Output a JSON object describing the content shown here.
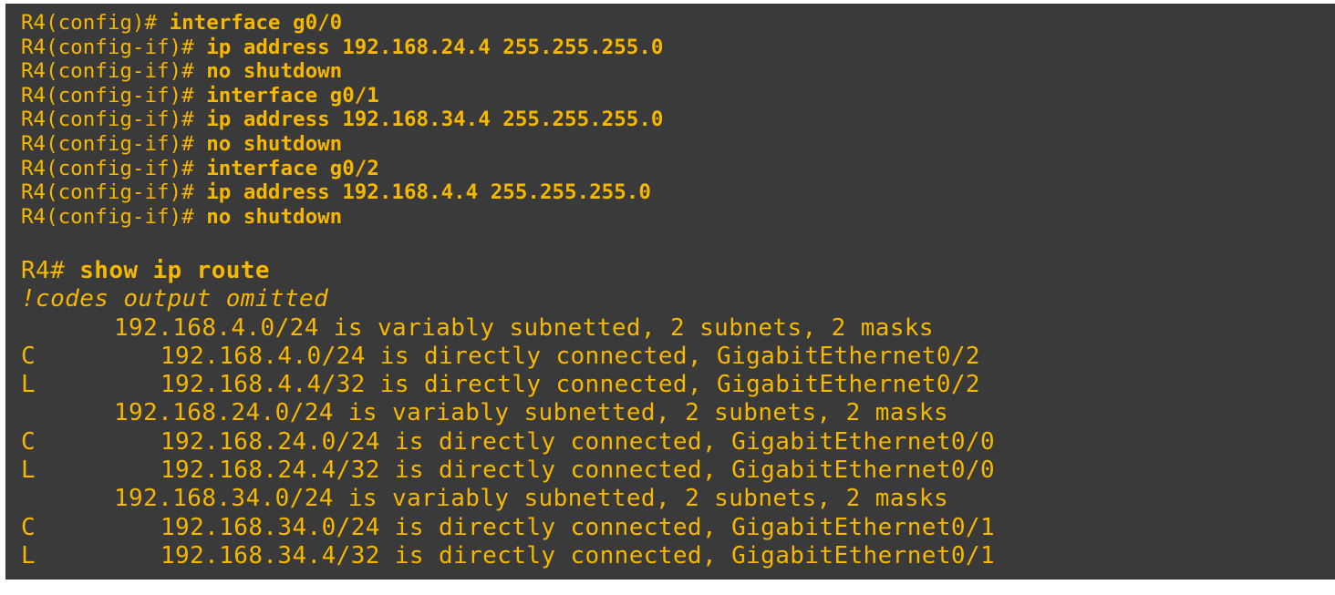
{
  "config": [
    {
      "prompt": "R4(config)# ",
      "command": "interface g0/0"
    },
    {
      "prompt": "R4(config-if)# ",
      "command": "ip address 192.168.24.4 255.255.255.0"
    },
    {
      "prompt": "R4(config-if)# ",
      "command": "no shutdown"
    },
    {
      "prompt": "R4(config-if)# ",
      "command": "interface g0/1"
    },
    {
      "prompt": "R4(config-if)# ",
      "command": "ip address 192.168.34.4 255.255.255.0"
    },
    {
      "prompt": "R4(config-if)# ",
      "command": "no shutdown"
    },
    {
      "prompt": "R4(config-if)# ",
      "command": "interface g0/2"
    },
    {
      "prompt": "R4(config-if)# ",
      "command": "ip address 192.168.4.4 255.255.255.0"
    },
    {
      "prompt": "R4(config-if)# ",
      "command": "no shutdown"
    }
  ],
  "show": {
    "prompt": "R4# ",
    "command": "show ip route",
    "comment": "!codes output omitted"
  },
  "routes": [
    {
      "code": "",
      "text": "192.168.4.0/24 is variably subnetted, 2 subnets, 2 masks"
    },
    {
      "code": "C",
      "text": "192.168.4.0/24 is directly connected, GigabitEthernet0/2"
    },
    {
      "code": "L",
      "text": "192.168.4.4/32 is directly connected, GigabitEthernet0/2"
    },
    {
      "code": "",
      "text": "192.168.24.0/24 is variably subnetted, 2 subnets, 2 masks"
    },
    {
      "code": "C",
      "text": "192.168.24.0/24 is directly connected, GigabitEthernet0/0"
    },
    {
      "code": "L",
      "text": "192.168.24.4/32 is directly connected, GigabitEthernet0/0"
    },
    {
      "code": "",
      "text": "192.168.34.0/24 is variably subnetted, 2 subnets, 2 masks"
    },
    {
      "code": "C",
      "text": "192.168.34.0/24 is directly connected, GigabitEthernet0/1"
    },
    {
      "code": "L",
      "text": "192.168.34.4/32 is directly connected, GigabitEthernet0/1"
    }
  ],
  "colors": {
    "background": "#3a3a3a",
    "text": "#f5b700",
    "page": "#ffffff"
  }
}
